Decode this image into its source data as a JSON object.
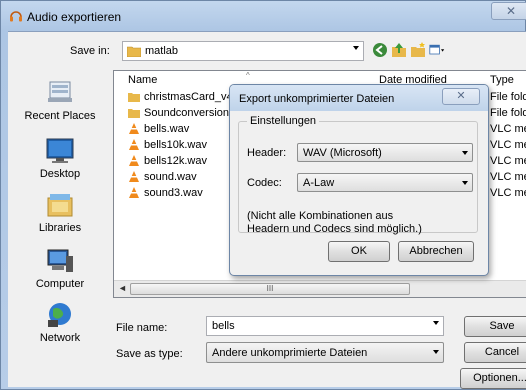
{
  "window": {
    "title": "Audio exportieren",
    "close_glyph": "✕"
  },
  "toolbar": {
    "save_in_label": "Save in:",
    "current_folder": "matlab"
  },
  "places": [
    {
      "label": "Recent Places",
      "icon": "recent-places-icon"
    },
    {
      "label": "Desktop",
      "icon": "desktop-icon"
    },
    {
      "label": "Libraries",
      "icon": "libraries-icon"
    },
    {
      "label": "Computer",
      "icon": "computer-icon"
    },
    {
      "label": "Network",
      "icon": "network-icon"
    }
  ],
  "columns": {
    "name": "Name",
    "date": "Date modified",
    "type": "Type"
  },
  "files": [
    {
      "name": "christmasCard_v4",
      "kind": "folder",
      "type": "File folde"
    },
    {
      "name": "Soundconversion",
      "kind": "folder",
      "type": "File folde"
    },
    {
      "name": "bells.wav",
      "kind": "vlc",
      "type": "VLC med"
    },
    {
      "name": "bells10k.wav",
      "kind": "vlc",
      "type": "VLC med"
    },
    {
      "name": "bells12k.wav",
      "kind": "vlc",
      "type": "VLC med"
    },
    {
      "name": "sound.wav",
      "kind": "vlc",
      "type": "VLC med"
    },
    {
      "name": "sound3.wav",
      "kind": "vlc",
      "type": "VLC med"
    }
  ],
  "scrollbar": {
    "grip": "III"
  },
  "form": {
    "file_name_label": "File name:",
    "file_name_value": "bells",
    "save_as_type_label": "Save as type:",
    "save_as_type_value": "Andere unkomprimierte Dateien"
  },
  "buttons": {
    "save": "Save",
    "cancel": "Cancel",
    "options": "Optionen..."
  },
  "modal": {
    "title": "Export unkomprimierter Dateien",
    "close_glyph": "✕",
    "group_title": "Einstellungen",
    "header_label": "Header:",
    "header_value": "WAV (Microsoft)",
    "codec_label": "Codec:",
    "codec_value": "A-Law",
    "note_line1": "(Nicht alle Kombinationen aus",
    "note_line2": "Headern und Codecs sind möglich.)",
    "ok": "OK",
    "cancel": "Abbrechen"
  },
  "colors": {
    "folder": "#e8b84a",
    "vlc_orange": "#f08a1c",
    "accent_blue": "#3a6fb0"
  }
}
